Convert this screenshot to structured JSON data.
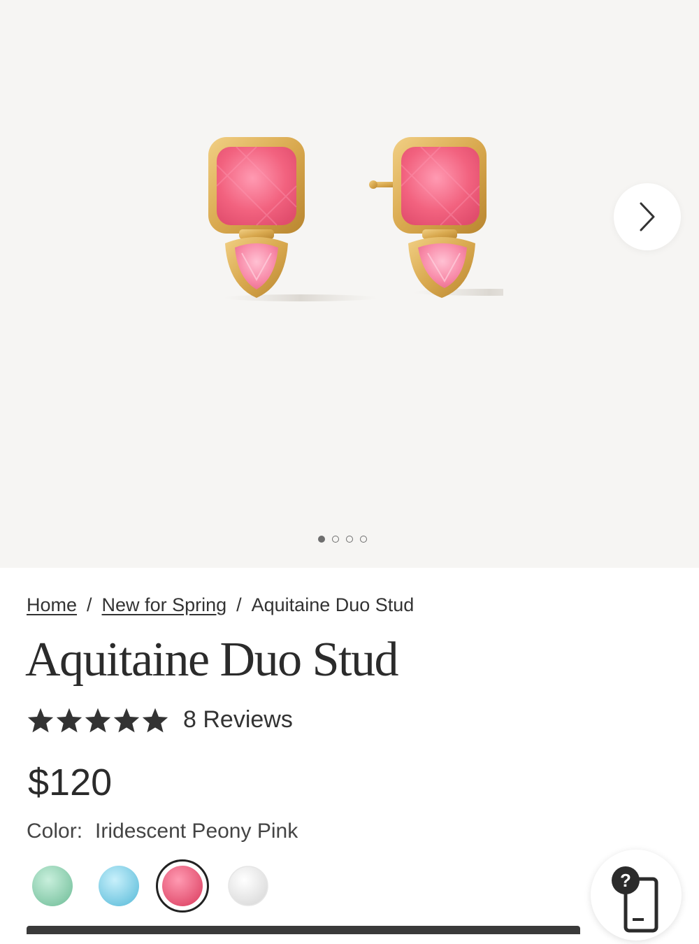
{
  "gallery": {
    "image_alt": "Aquitaine Duo Stud earrings",
    "next_icon": "chevron-right-icon",
    "dots_total": 4,
    "active_dot": 1
  },
  "breadcrumb": {
    "home": "Home",
    "sep": "/",
    "category": "New for Spring",
    "current": "Aquitaine Duo Stud"
  },
  "product": {
    "title": "Aquitaine Duo Stud",
    "rating": 5,
    "reviews": "8 Reviews",
    "price": "$120",
    "color_label": "Color:",
    "color_value": "Iridescent Peony Pink"
  },
  "swatches": [
    {
      "name": "mint",
      "color": "#8fd0b0",
      "selected": false
    },
    {
      "name": "aqua",
      "color": "#7fcfe6",
      "selected": false
    },
    {
      "name": "peony-pink",
      "color": "#e8567a",
      "selected": true
    },
    {
      "name": "clear",
      "color": "#f1f1f1",
      "selected": false
    }
  ],
  "colors": {
    "gold": "#d9a94f",
    "stone_pink": "#f26a8a",
    "accent_dark": "#222222"
  },
  "help_icon": "help-chat-icon"
}
